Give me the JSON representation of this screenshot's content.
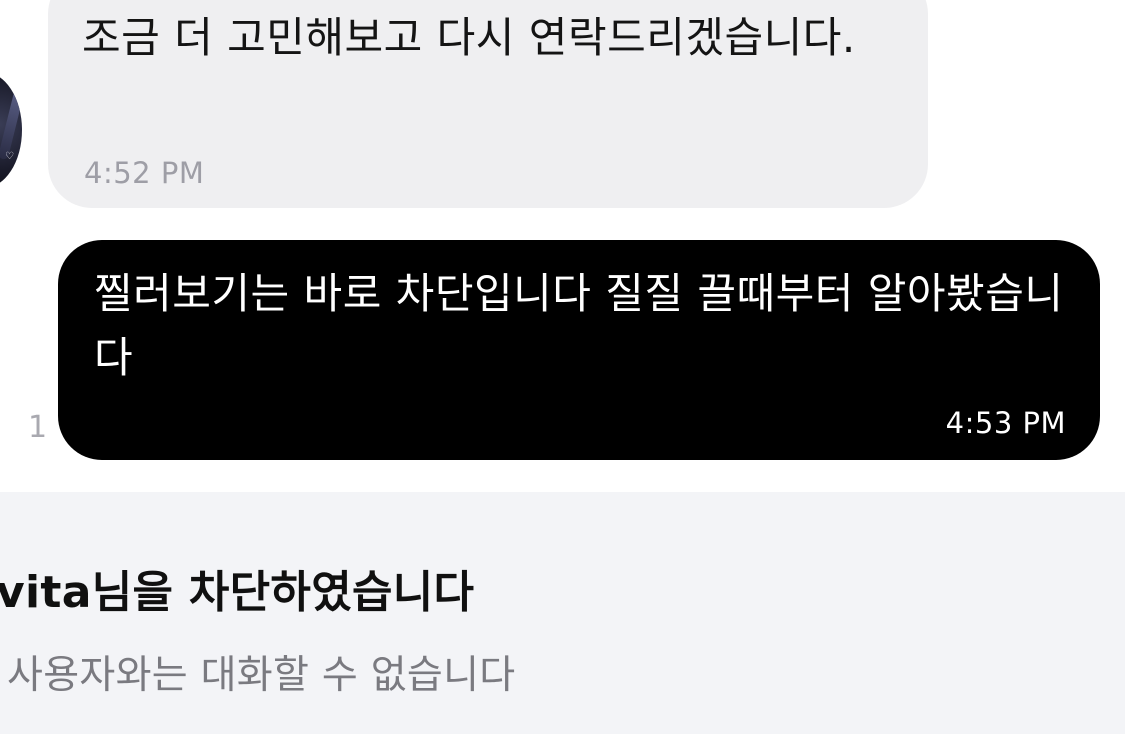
{
  "conversation": {
    "incoming_message": {
      "text": "조금 더 고민해보고 다시 연락드리겠습니다.",
      "time": "4:52 PM"
    },
    "outgoing_message": {
      "text": "찔러보기는 바로 차단입니다 질질 끌때부터 알아봤습니다",
      "time": "4:53 PM",
      "unread_count": "1"
    }
  },
  "blocked_notice": {
    "title": "vita님을 차단하였습니다",
    "subtitle": "r 사용자와는 대화할 수 없습니다"
  }
}
